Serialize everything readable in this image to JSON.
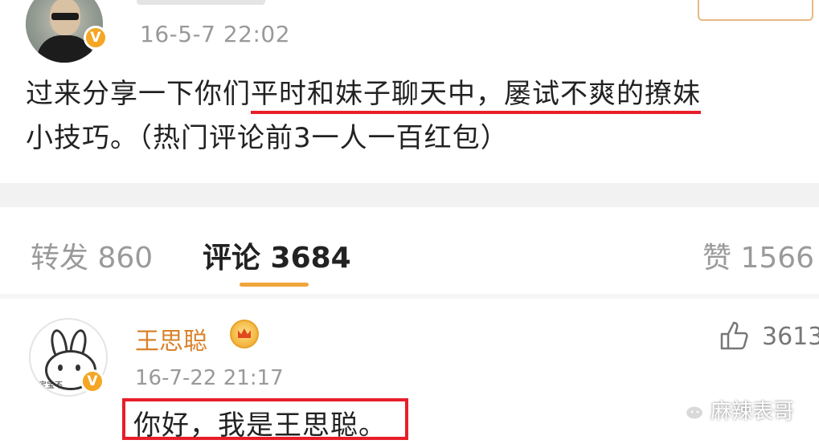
{
  "post": {
    "time": "16-5-7 22:02",
    "verified_badge": "V",
    "text_before": "过来分享一下你们",
    "text_highlight": "平时和妹子聊天中，屡试不爽的撩妹",
    "text_after": "小技巧。（热门评论前3一人一百红包）"
  },
  "tabs": {
    "repost": "转发 860",
    "comments": "评论 3684",
    "likes": "赞 1566"
  },
  "comment": {
    "user_name": "王思聪",
    "verified_badge": "V",
    "like_count": "3613",
    "time": "16-7-22 21:17",
    "text": "你好，我是王思聪。",
    "avatar_caption": "宝宝不"
  },
  "watermark": {
    "text": "麻辣表哥"
  },
  "colors": {
    "highlight_red": "#e81e2a",
    "accent_orange": "#f0a53a",
    "username_orange": "#d9822b",
    "verified_orange": "#f5a623"
  },
  "icons": [
    "verified-icon",
    "crown-icon",
    "like-thumb-icon",
    "wechat-icon"
  ]
}
